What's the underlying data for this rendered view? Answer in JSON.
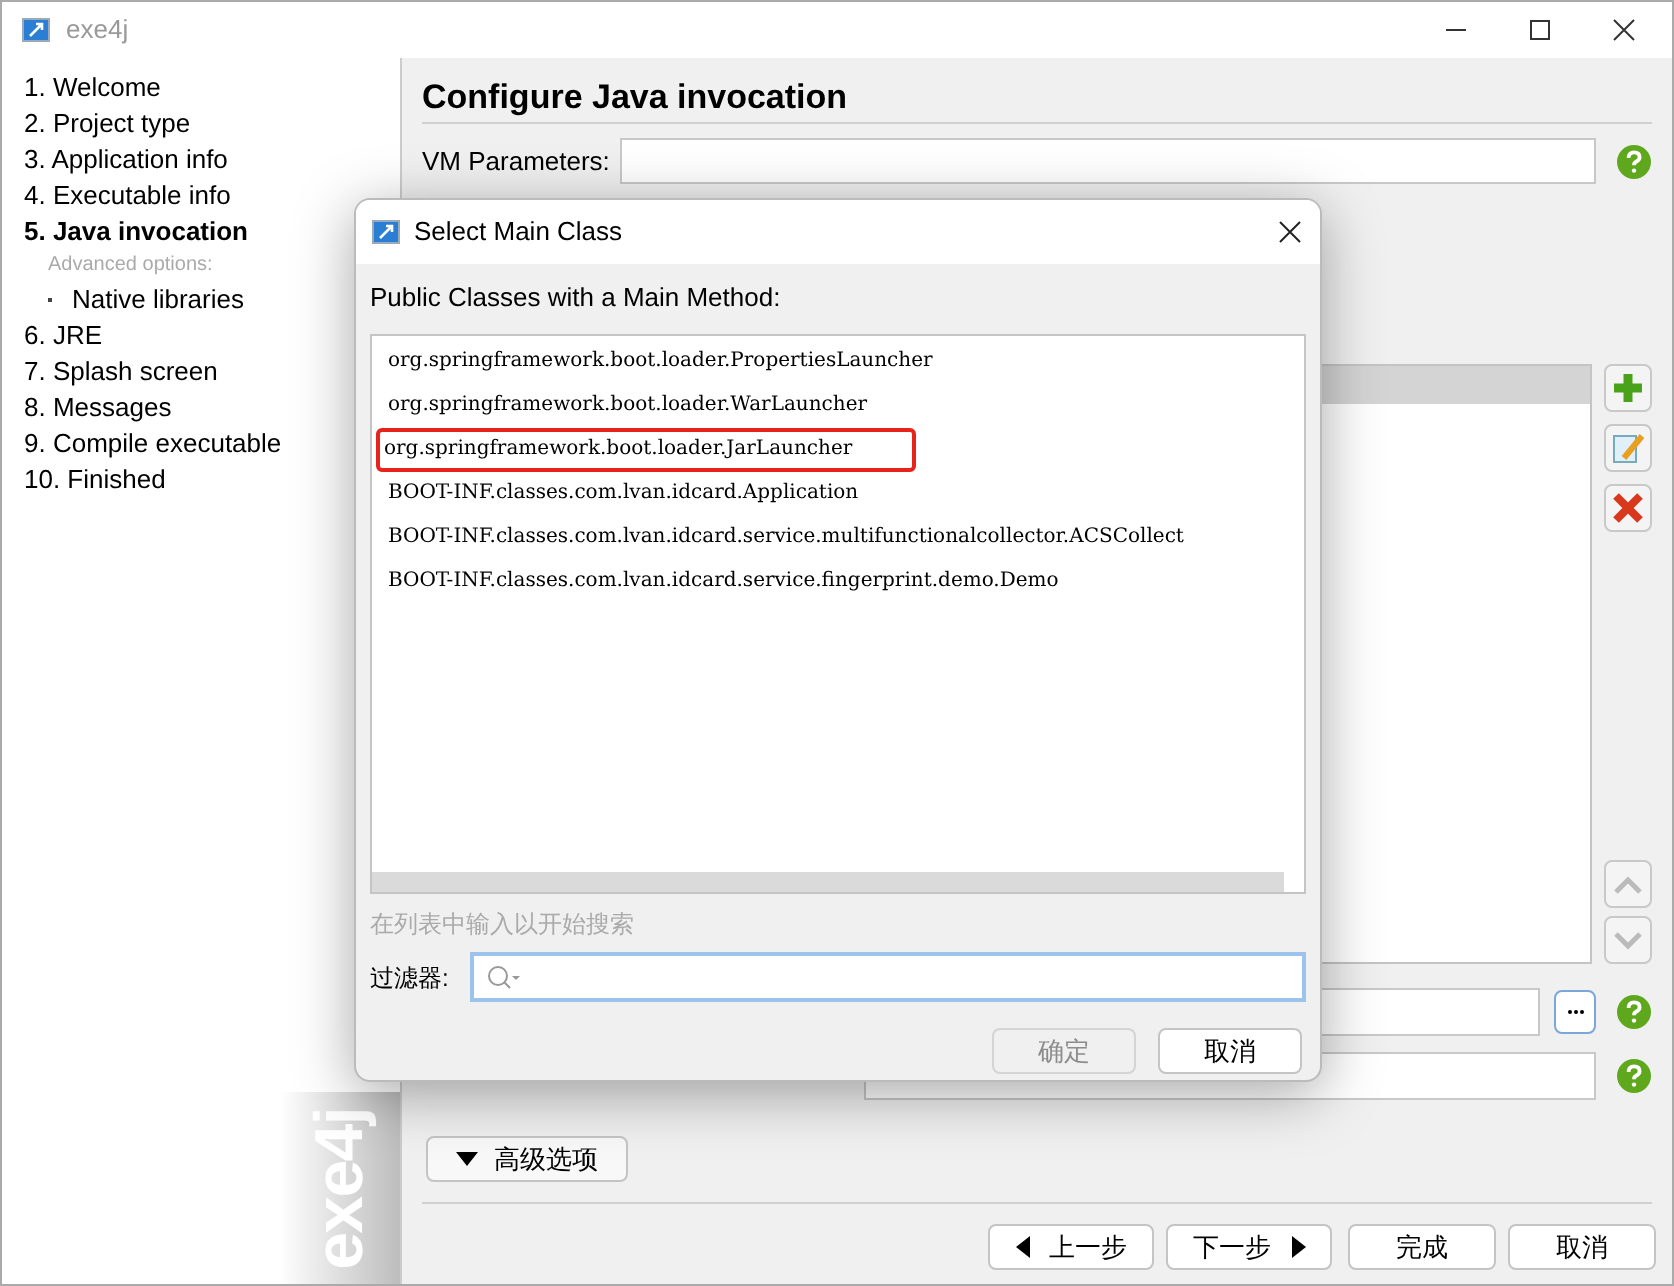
{
  "window": {
    "title": "exe4j"
  },
  "sidebar": {
    "items": [
      {
        "label": "1. Welcome",
        "selected": false
      },
      {
        "label": "2. Project type",
        "selected": false
      },
      {
        "label": "3. Application info",
        "selected": false
      },
      {
        "label": "4. Executable info",
        "selected": false
      },
      {
        "label": "5. Java invocation",
        "selected": true,
        "subheading": "Advanced options:",
        "children": [
          {
            "label": "Native libraries",
            "selected": false
          }
        ]
      },
      {
        "label": "6. JRE",
        "selected": false
      },
      {
        "label": "7. Splash screen",
        "selected": false
      },
      {
        "label": "8. Messages",
        "selected": false
      },
      {
        "label": "9. Compile executable",
        "selected": false
      },
      {
        "label": "10. Finished",
        "selected": false
      }
    ],
    "logo": "exe4j"
  },
  "main": {
    "title": "Configure Java invocation",
    "vm_parameters": {
      "label": "VM Parameters:"
    },
    "advanced_button": "高级选项"
  },
  "dialog": {
    "title": "Select Main Class",
    "list_label": "Public Classes with a Main Method:",
    "classes": [
      {
        "name": "org.springframework.boot.loader.PropertiesLauncher",
        "marked": false
      },
      {
        "name": "org.springframework.boot.loader.WarLauncher",
        "marked": false
      },
      {
        "name": "org.springframework.boot.loader.JarLauncher",
        "marked": true
      },
      {
        "name": "BOOT-INF.classes.com.lvan.idcard.Application",
        "marked": false
      },
      {
        "name": "BOOT-INF.classes.com.lvan.idcard.service.multifunctionalcollector.ACSCollect",
        "marked": false
      },
      {
        "name": "BOOT-INF.classes.com.lvan.idcard.service.fingerprint.demo.Demo",
        "marked": false
      }
    ],
    "hint": "在列表中输入以开始搜索",
    "filter_label": "过滤器:",
    "buttons": [
      {
        "label": "确定",
        "disabled": true
      },
      {
        "label": "取消",
        "disabled": false
      }
    ]
  },
  "footer": {
    "buttons": [
      {
        "label": "上一步",
        "kind": "back"
      },
      {
        "label": "下一步",
        "kind": "next"
      },
      {
        "label": "完成",
        "kind": "plain"
      },
      {
        "label": "取消",
        "kind": "plain"
      }
    ]
  }
}
